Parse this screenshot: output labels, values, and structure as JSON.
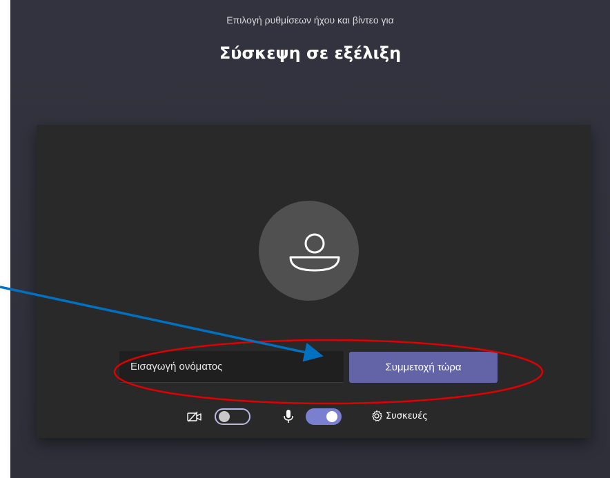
{
  "header": {
    "subtitle": "Επιλογή ρυθμίσεων ήχου και βίντεο για",
    "title": "Σύσκεψη σε εξέλιξη"
  },
  "join": {
    "name_placeholder": "Εισαγωγή ονόματος",
    "name_value": "",
    "join_button_label": "Συμμετοχή τώρα"
  },
  "controls": {
    "camera": {
      "icon": "camera-off-icon",
      "enabled": false
    },
    "microphone": {
      "icon": "microphone-icon",
      "enabled": true
    },
    "devices": {
      "icon": "gear-icon",
      "label": "Συσκευές"
    }
  },
  "colors": {
    "background": "#33333f",
    "preview": "#292929",
    "avatar": "#505050",
    "accent": "#6264a7",
    "toggle_on": "#7b7fd0",
    "annotation_ellipse": "#e00000",
    "annotation_arrow": "#0070c0"
  }
}
